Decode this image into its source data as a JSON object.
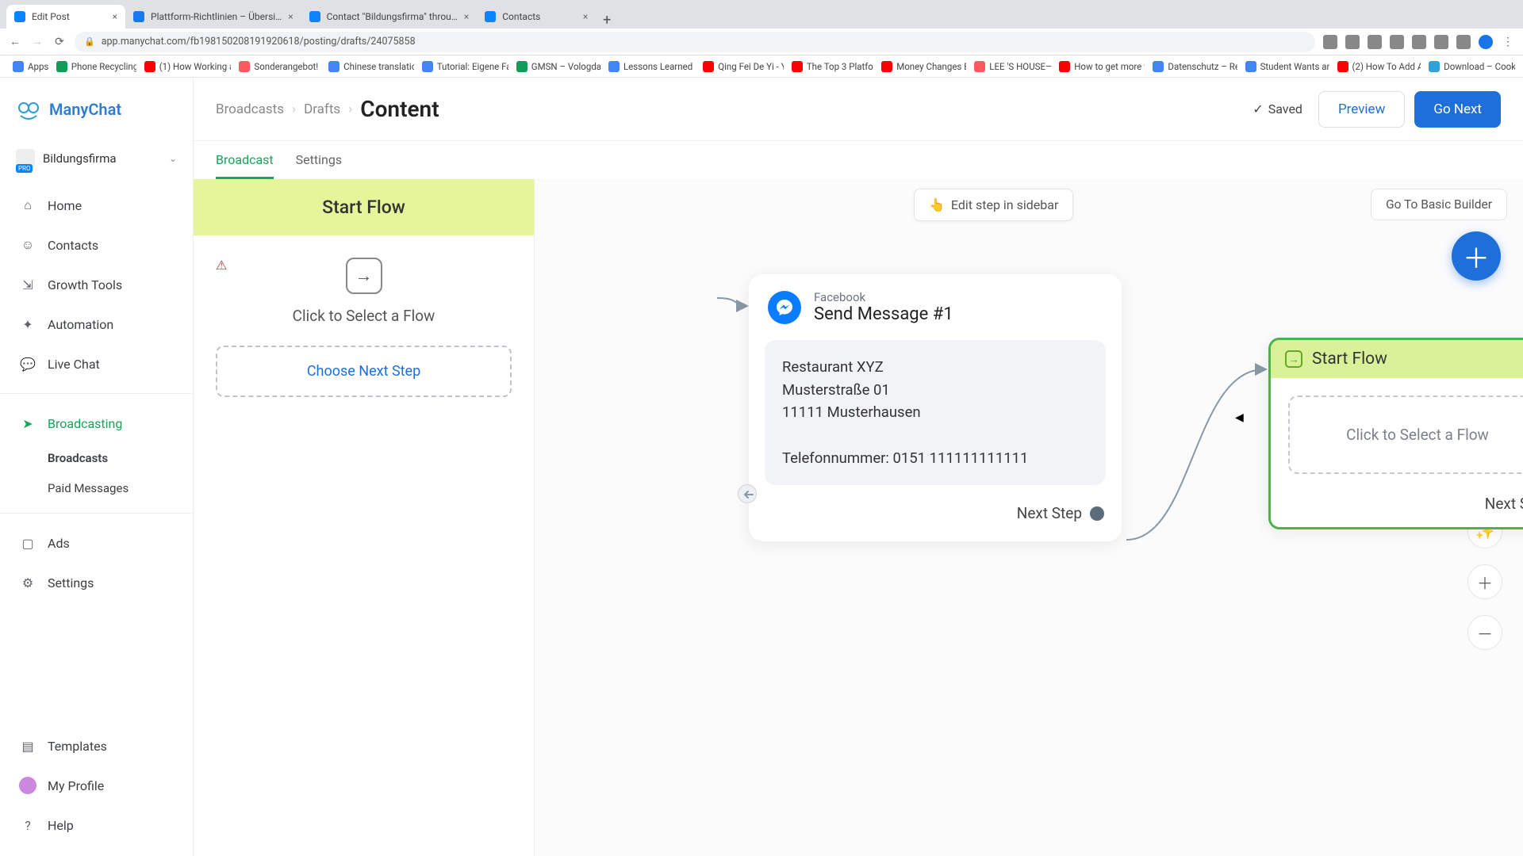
{
  "browser": {
    "tabs": [
      {
        "title": "Edit Post",
        "fav": "mc",
        "active": true
      },
      {
        "title": "Plattform-Richtlinien – Übersi…",
        "fav": "fb",
        "active": false
      },
      {
        "title": "Contact \"Bildungsfirma\" throu…",
        "fav": "mc",
        "active": false
      },
      {
        "title": "Contacts",
        "fav": "mc",
        "active": false
      }
    ],
    "url": "app.manychat.com/fb198150208191920618/posting/drafts/24075858",
    "bookmarks": [
      {
        "t": "Apps",
        "c": "blue"
      },
      {
        "t": "Phone Recycling…",
        "c": "green"
      },
      {
        "t": "(1) How Working a…",
        "c": "red"
      },
      {
        "t": "Sonderangebot! |…",
        "c": "air"
      },
      {
        "t": "Chinese translatio…",
        "c": "blue"
      },
      {
        "t": "Tutorial: Eigene Fa…",
        "c": "blue"
      },
      {
        "t": "GMSN – Vologda,…",
        "c": "green"
      },
      {
        "t": "Lessons Learned f…",
        "c": "blue"
      },
      {
        "t": "Qing Fei De Yi - Y…",
        "c": "red"
      },
      {
        "t": "The Top 3 Platfor…",
        "c": "red"
      },
      {
        "t": "Money Changes E…",
        "c": "red"
      },
      {
        "t": "LEE 'S HOUSE—…",
        "c": "air"
      },
      {
        "t": "How to get more v…",
        "c": "red"
      },
      {
        "t": "Datenschutz – Re…",
        "c": "blue"
      },
      {
        "t": "Student Wants an…",
        "c": "blue"
      },
      {
        "t": "(2) How To Add A…",
        "c": "red"
      },
      {
        "t": "Download – Cooki…",
        "c": "cook"
      }
    ]
  },
  "brand": "ManyChat",
  "account": {
    "name": "Bildungsfirma"
  },
  "sidebar": {
    "items": [
      {
        "label": "Home"
      },
      {
        "label": "Contacts"
      },
      {
        "label": "Growth Tools"
      },
      {
        "label": "Automation"
      },
      {
        "label": "Live Chat"
      },
      {
        "label": "Broadcasting",
        "active": true,
        "subs": [
          {
            "label": "Broadcasts",
            "active": true
          },
          {
            "label": "Paid Messages"
          }
        ]
      },
      {
        "label": "Ads"
      },
      {
        "label": "Settings"
      }
    ],
    "bottom": [
      {
        "label": "Templates"
      },
      {
        "label": "My Profile"
      },
      {
        "label": "Help"
      }
    ]
  },
  "header": {
    "crumbs": [
      "Broadcasts",
      "Drafts"
    ],
    "current": "Content",
    "saved": "Saved",
    "preview": "Preview",
    "gonext": "Go Next"
  },
  "subtabs": {
    "broadcast": "Broadcast",
    "settings": "Settings"
  },
  "canvas": {
    "editTip": "Edit step in sidebar",
    "goBasic": "Go To Basic Builder",
    "panel": {
      "title": "Start Flow",
      "selectFlow": "Click to Select a Flow",
      "chooseNext": "Choose Next Step"
    },
    "msgNode": {
      "platform": "Facebook",
      "title": "Send Message #1",
      "body": "Restaurant XYZ\nMusterstraße 01\n11111 Musterhausen\n\nTelefonnummer: 0151 111111111111",
      "next": "Next Step"
    },
    "flowNode": {
      "title": "Start Flow",
      "select": "Click to Select a Flow",
      "next": "Next Step"
    }
  }
}
